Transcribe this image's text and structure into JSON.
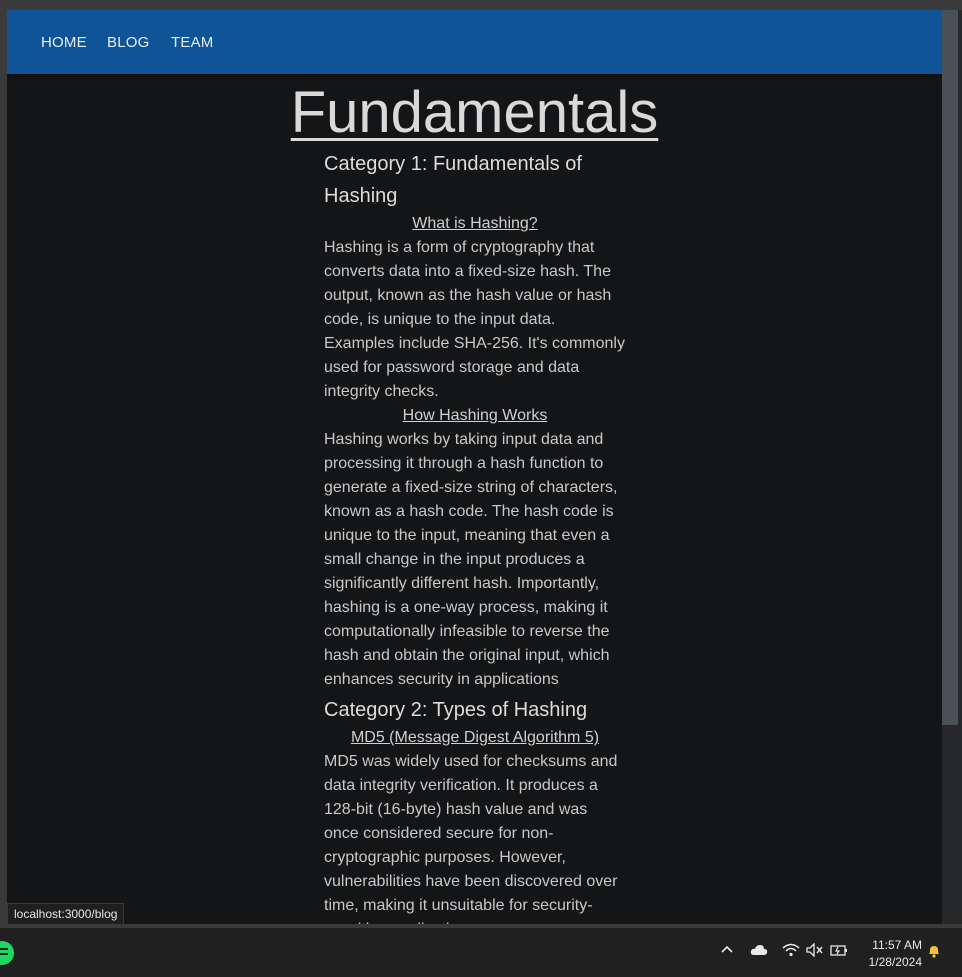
{
  "nav": {
    "items": [
      {
        "label": "HOME"
      },
      {
        "label": "BLOG"
      },
      {
        "label": "TEAM"
      }
    ]
  },
  "page": {
    "title": "Fundamentals",
    "category1": {
      "heading": "Category 1: Fundamentals of Hashing",
      "sections": [
        {
          "title": "What is Hashing?",
          "body": "Hashing is a form of cryptography that converts data into a fixed-size hash. The output, known as the hash value or hash code, is unique to the input data. Examples include SHA-256. It's commonly used for password storage and data integrity checks."
        },
        {
          "title": "How Hashing Works",
          "body": "Hashing works by taking input data and processing it through a hash function to generate a fixed-size string of characters, known as a hash code. The hash code is unique to the input, meaning that even a small change in the input produces a significantly different hash. Importantly, hashing is a one-way process, making it computationally infeasible to reverse the hash and obtain the original input, which enhances security in applications"
        }
      ]
    },
    "category2": {
      "heading": "Category 2: Types of Hashing",
      "sections": [
        {
          "title": "MD5 (Message Digest Algorithm 5)",
          "body": "MD5 was widely used for checksums and data integrity verification. It produces a 128-bit (16-byte) hash value and was once considered secure for non-cryptographic purposes. However, vulnerabilities have been discovered over time, making it unsuitable for security-sensitive applications."
        }
      ]
    }
  },
  "status_bar": {
    "url": "localhost:3000/blog"
  },
  "taskbar": {
    "time": "11:57 AM",
    "date": "1/28/2024",
    "icons": [
      "spotify-icon",
      "chevron-up-icon",
      "cloud-icon",
      "wifi-icon",
      "speaker-muted-icon",
      "battery-icon",
      "bell-icon"
    ]
  },
  "colors": {
    "navbar": "#0f5496",
    "page_background": "#141517",
    "text": "#c8c8c8",
    "notification": "#f2c230"
  }
}
